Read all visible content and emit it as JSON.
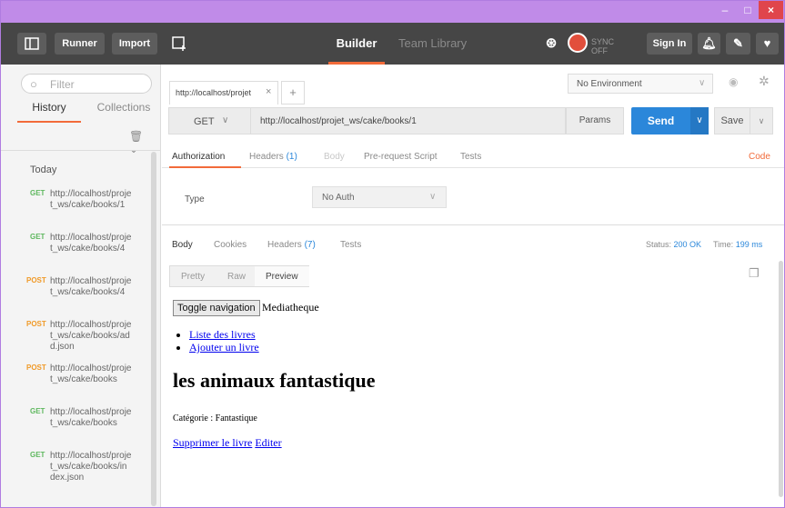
{
  "window": {
    "minimize": "–",
    "maximize": "□",
    "close": "×"
  },
  "toolbar": {
    "sidebar_toggle_icon": "sidebar-icon",
    "runner_label": "Runner",
    "import_label": "Import",
    "new_window_icon": "new-window-icon",
    "builder_label": "Builder",
    "team_library_label": "Team Library",
    "sync_label": "SYNC OFF",
    "signin_label": "Sign In",
    "accent": "#f26b3a"
  },
  "sidebar": {
    "filter_placeholder": "Filter",
    "tabs": [
      "History",
      "Collections"
    ],
    "today_label": "Today",
    "history": [
      {
        "method": "GET",
        "url": "http://localhost/projet_ws/cake/books/1"
      },
      {
        "method": "GET",
        "url": "http://localhost/projet_ws/cake/books/4"
      },
      {
        "method": "POST",
        "url": "http://localhost/projet_ws/cake/books/4"
      },
      {
        "method": "POST",
        "url": "http://localhost/projet_ws/cake/books/add.json"
      },
      {
        "method": "POST",
        "url": "http://localhost/projet_ws/cake/books"
      },
      {
        "method": "GET",
        "url": "http://localhost/projet_ws/cake/books"
      },
      {
        "method": "GET",
        "url": "http://localhost/projet_ws/cake/books/index.json"
      }
    ]
  },
  "request": {
    "tab_title": "http://localhost/projet",
    "environment": "No Environment",
    "method": "GET",
    "url": "http://localhost/projet_ws/cake/books/1",
    "params_label": "Params",
    "send_label": "Send",
    "save_label": "Save",
    "tabs": {
      "authorization": "Authorization",
      "headers": "Headers",
      "headers_count": "(1)",
      "body": "Body",
      "prerequest": "Pre-request Script",
      "tests": "Tests",
      "code": "Code"
    },
    "auth": {
      "type_label": "Type",
      "type_value": "No Auth"
    }
  },
  "response": {
    "tabs": {
      "body": "Body",
      "cookies": "Cookies",
      "headers": "Headers",
      "headers_count": "(7)",
      "tests": "Tests"
    },
    "status_label": "Status:",
    "status_value": "200 OK",
    "time_label": "Time:",
    "time_value": "199 ms",
    "view_modes": [
      "Pretty",
      "Raw",
      "Preview"
    ],
    "preview": {
      "toggle_button": "Toggle navigation",
      "brand": "Mediatheque",
      "nav_links": [
        "Liste des livres",
        "Ajouter un livre"
      ],
      "book_title": "les animaux fantastique",
      "category": "Catégorie : Fantastique",
      "delete_link": "Supprimer le livre",
      "edit_link": "Editer"
    }
  }
}
